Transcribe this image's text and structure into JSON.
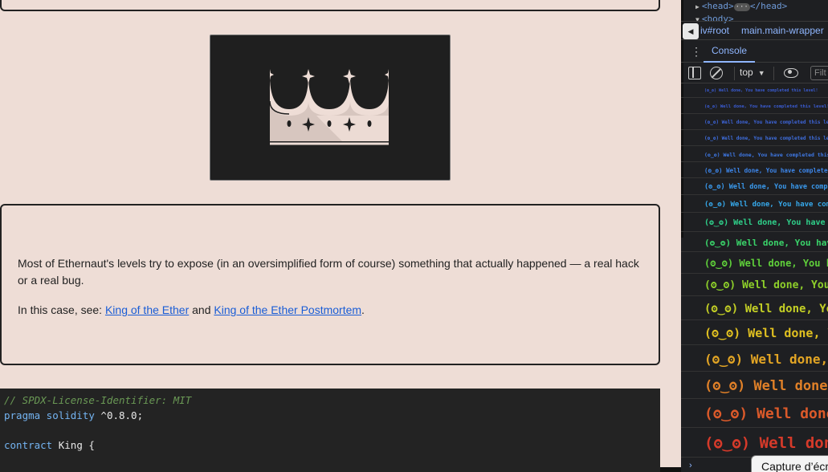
{
  "article": {
    "paragraph1": "Most of Ethernaut's levels try to expose (in an oversimplified form of course) something that actually happened — a real hack or a real bug.",
    "p2_prefix": "In this case, see: ",
    "link1": "King of the Ether",
    "p2_and": " and ",
    "link2": "King of the Ether Postmortem",
    "p2_suffix": "."
  },
  "code": {
    "lines": [
      {
        "parts": [
          {
            "t": "// SPDX-License-Identifier: MIT",
            "c": "cm"
          }
        ]
      },
      {
        "parts": [
          {
            "t": "pragma solidity",
            "c": "kw"
          },
          {
            "t": " ^0.8.0;",
            "c": "ty"
          }
        ]
      },
      {
        "parts": []
      },
      {
        "parts": [
          {
            "t": "contract",
            "c": "kw"
          },
          {
            "t": " King {",
            "c": "ty"
          }
        ]
      }
    ]
  },
  "devtools": {
    "dom": {
      "head_open": "<head>",
      "head_ellipsis": "···",
      "head_close": "</head>",
      "body": "<body>"
    },
    "breadcrumbs": {
      "item1": "iv#root",
      "item2": "main.main-wrapper"
    },
    "tab_console": "Console",
    "context": "top",
    "filter_placeholder": "Filt",
    "logs": [
      {
        "text": "(ʘ‿ʘ) Well done, You have completed this level!",
        "color": "#3a5bd0",
        "size": 5
      },
      {
        "text": "(ʘ‿ʘ) Well done, You have completed this level!",
        "color": "#3a5bd0",
        "size": 5.5
      },
      {
        "text": "(ʘ‿ʘ) Well done, You have completed this level!",
        "color": "#3d64d8",
        "size": 6
      },
      {
        "text": "(ʘ‿ʘ) Well done, You have completed this level!",
        "color": "#3f6fe0",
        "size": 6
      },
      {
        "text": "(ʘ‿ʘ) Well done, You have completed this level!",
        "color": "#3f79e6",
        "size": 6.5
      },
      {
        "text": "(ʘ‿ʘ) Well done, You have completed this level!",
        "color": "#3d86ea",
        "size": 7.5
      },
      {
        "text": "(ʘ‿ʘ) Well done, You have completed this level!",
        "color": "#3a99ec",
        "size": 8.5
      },
      {
        "text": "(ʘ‿ʘ) Well done, You have completed this level!",
        "color": "#36a8ea",
        "size": 9
      },
      {
        "text": "(ʘ‿ʘ) Well done, You have completed this level!",
        "color": "#2fd08a",
        "size": 10
      },
      {
        "text": "(ʘ‿ʘ) Well done, You have completed this level!",
        "color": "#3ad46a",
        "size": 11
      },
      {
        "text": "(ʘ‿ʘ) Well done, You have completed this level!",
        "color": "#5fd03a",
        "size": 12
      },
      {
        "text": "(ʘ‿ʘ) Well done, You have completed this level!",
        "color": "#8ed02a",
        "size": 13
      },
      {
        "text": "(ʘ‿ʘ) Well done, You have completed this level!",
        "color": "#c3cf25",
        "size": 14
      },
      {
        "text": "(ʘ‿ʘ) Well done, You have completed this level!",
        "color": "#e0c020",
        "size": 15
      },
      {
        "text": "(ʘ‿ʘ) Well done, You have completed this level!",
        "color": "#e3a524",
        "size": 16
      },
      {
        "text": "(ʘ‿ʘ) Well done, You have completed this level!",
        "color": "#e08028",
        "size": 17
      },
      {
        "text": "(ʘ‿ʘ) Well done, You have completed this level!",
        "color": "#dc5a2a",
        "size": 18
      },
      {
        "text": "(ʘ‿ʘ) Well done, You have completed this level!",
        "color": "#d63a2a",
        "size": 19
      }
    ],
    "prompt": "›"
  },
  "screenshot_button": "Capture d’écran",
  "icons": [
    "crown-image",
    "sidebar-icon",
    "clear-icon",
    "eye-icon",
    "menu-dots-icon",
    "back-arrow-icon"
  ]
}
